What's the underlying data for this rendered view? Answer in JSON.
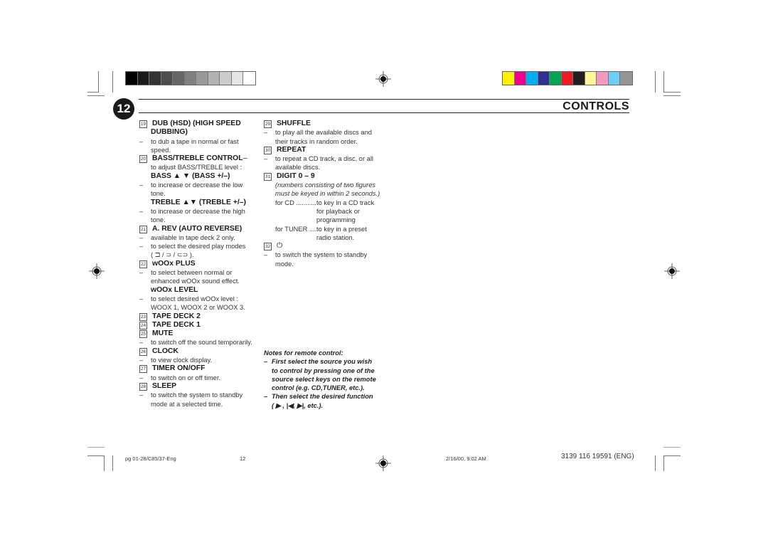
{
  "color_bars": {
    "grayscale": [
      "#000000",
      "#1a1a1a",
      "#333333",
      "#4d4d4d",
      "#666666",
      "#808080",
      "#999999",
      "#b3b3b3",
      "#cccccc",
      "#e6e6e6",
      "#ffffff"
    ],
    "process": [
      "#fff200",
      "#ec008c",
      "#00aeef",
      "#2e3192",
      "#00a651",
      "#ed1c24",
      "#231f20",
      "#fff799",
      "#f49ac1",
      "#6dcff6",
      "#939598"
    ]
  },
  "header": {
    "page_number": "12",
    "title": "CONTROLS"
  },
  "column1": [
    {
      "num": "19",
      "label": "DUB (HSD) (HIGH SPEED",
      "label2": "DUBBING)",
      "desc": "to dub a tape in normal or fast",
      "desc2": "speed."
    },
    {
      "num": "20",
      "label": "BASS/TREBLE CONTROL",
      "label_suffix": " –",
      "line": "to adjust BASS/TREBLE level :",
      "sub1": "BASS ▲ ▼  (BASS +/–)",
      "sub1_desc": "to increase or decrease the low",
      "sub1_desc2": "tone.",
      "sub2": "TREBLE ▲▼ (TREBLE +/–)",
      "sub2_desc": "to increase or decrease the high",
      "sub2_desc2": "tone."
    },
    {
      "num": "21",
      "label": "A. REV (AUTO REVERSE)",
      "desc": "available in tape deck 2 only.",
      "desc_b": "to select the desired play modes",
      "desc_b2": "( ⊐ / ⊃ / ⊂⊃ )."
    },
    {
      "num": "22",
      "label": "wOOx PLUS",
      "desc": "to select between normal or",
      "desc2": "enhanced wOOx sound effect.",
      "sub1": "wOOx LEVEL",
      "sub1_desc": "to select desired wOOx level :",
      "sub1_desc2": "WOOX 1, WOOX 2 or WOOX 3."
    },
    {
      "num": "23",
      "label": "TAPE DECK 2"
    },
    {
      "num": "24",
      "label": "TAPE DECK 1"
    },
    {
      "num": "25",
      "label": "MUTE",
      "desc": "to switch off the sound temporarily."
    },
    {
      "num": "26",
      "label": "CLOCK",
      "desc": "to view clock display."
    },
    {
      "num": "27",
      "label": "TIMER ON/OFF",
      "desc": "to switch on or off timer."
    },
    {
      "num": "28",
      "label": "SLEEP",
      "desc": "to switch the system to standby",
      "desc2": "mode at a selected time."
    }
  ],
  "column2": [
    {
      "num": "29",
      "label": "SHUFFLE",
      "desc": "to play all the available discs and",
      "desc2": "their tracks in random order."
    },
    {
      "num": "30",
      "label": "REPEAT",
      "desc": "to repeat a CD track, a disc, or all",
      "desc2": "available discs."
    },
    {
      "num": "31",
      "label": "DIGIT  0 – 9",
      "note": "(numbers consisting of two figures",
      "note2": "must be keyed in within 2 seconds.)",
      "cd_key": "for CD ...........",
      "cd_desc": [
        "to key in a CD track",
        "for playback or",
        "programming"
      ],
      "tuner_key": "for TUNER ....",
      "tuner_desc": [
        "to key in a preset",
        "radio station."
      ]
    },
    {
      "num": "32",
      "label": "⏻",
      "desc": "to switch the system to standby",
      "desc2": "mode."
    }
  ],
  "notes": {
    "title": "Notes for remote control:",
    "items": [
      [
        "First select the source you wish",
        "to control by pressing one of the",
        "source select keys on the remote",
        "control (e.g.  CD,TUNER, etc.)."
      ],
      [
        "Then select the desired function",
        "( ▶ , |◀,  ▶|,  etc.)."
      ]
    ]
  },
  "footer": {
    "file": "pg 01-28/C85/37-Eng",
    "page": "12",
    "datetime": "2/16/00, 9:02 AM",
    "code": "3139 116 19591 (ENG)"
  }
}
